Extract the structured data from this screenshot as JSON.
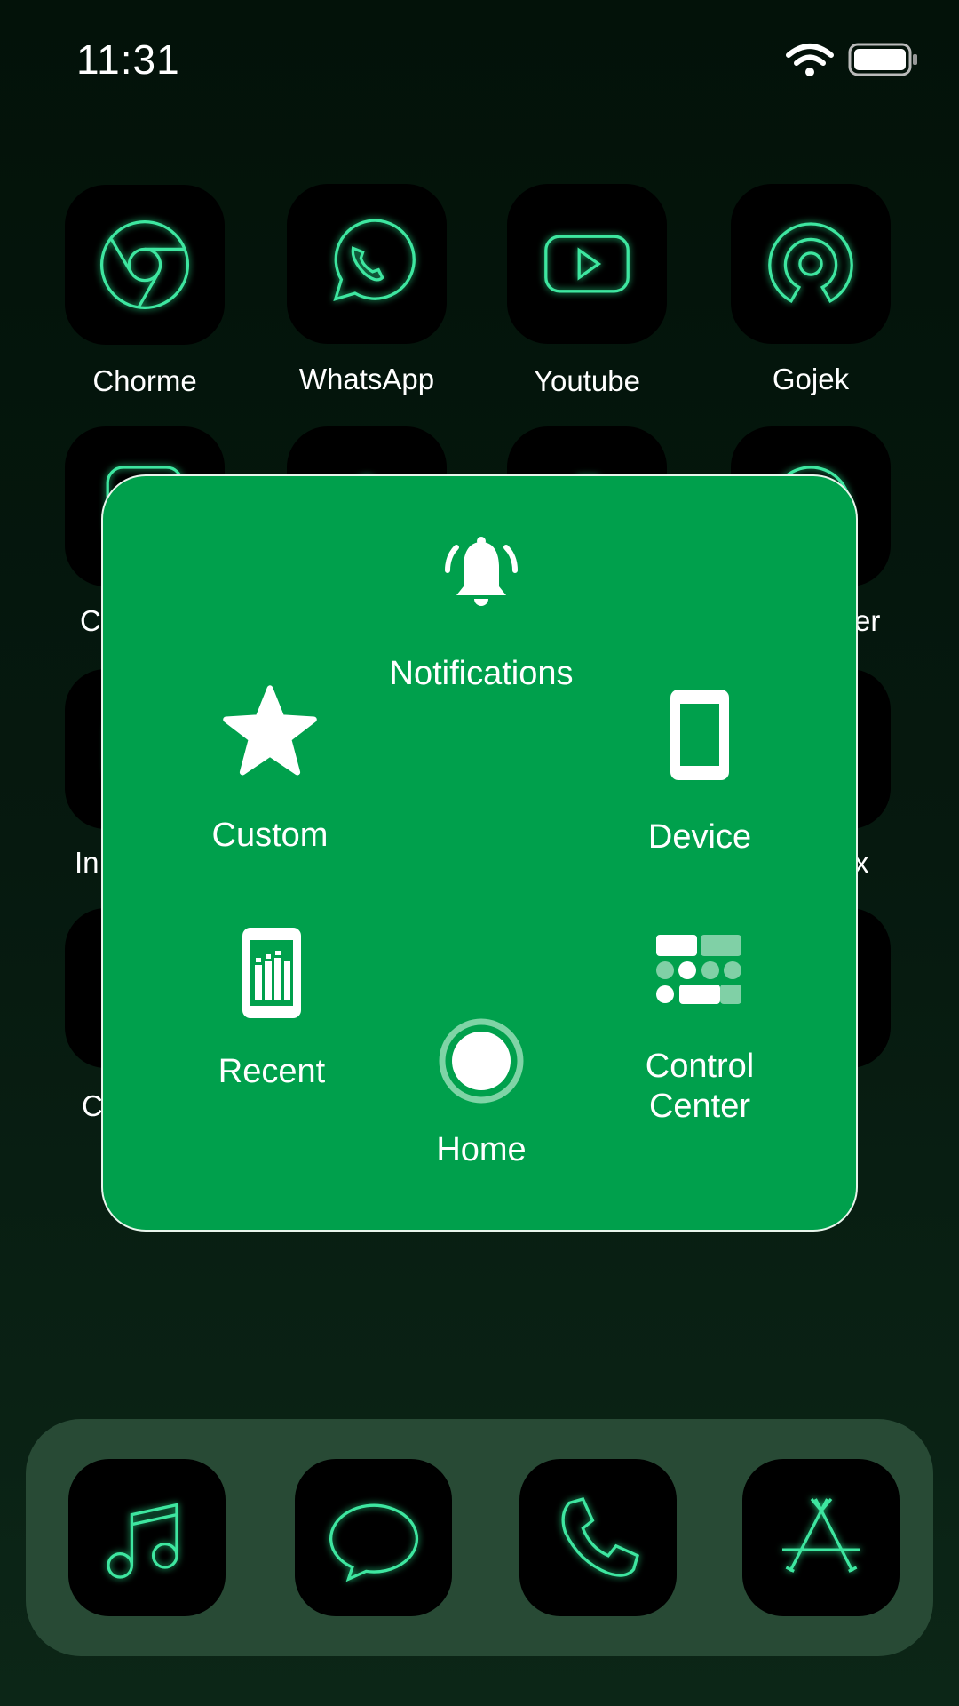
{
  "status_bar": {
    "time": "11:31",
    "wifi_icon": "wifi-icon",
    "battery_icon": "battery-full-icon"
  },
  "home_screen": {
    "row1": [
      {
        "label": "Chorme",
        "icon": "chrome-icon"
      },
      {
        "label": "WhatsApp",
        "icon": "whatsapp-icon"
      },
      {
        "label": "Youtube",
        "icon": "youtube-icon"
      },
      {
        "label": "Gojek",
        "icon": "gojek-icon"
      }
    ],
    "partial_labels": {
      "row2_left": "C",
      "row2_right": "er",
      "row3_left": "In",
      "row3_right": "x",
      "row4_left": "C"
    }
  },
  "assistive_menu": {
    "accent_color": "#00a04c",
    "items": {
      "notifications": "Notifications",
      "custom": "Custom",
      "device": "Device",
      "recent": "Recent",
      "home": "Home",
      "control_center_1": "Control",
      "control_center_2": "Center"
    }
  },
  "dock": {
    "apps": [
      "music-icon",
      "messages-icon",
      "phone-icon",
      "app-store-icon"
    ]
  },
  "colors": {
    "neon": "#3ee6a0",
    "background": "#06190f"
  }
}
